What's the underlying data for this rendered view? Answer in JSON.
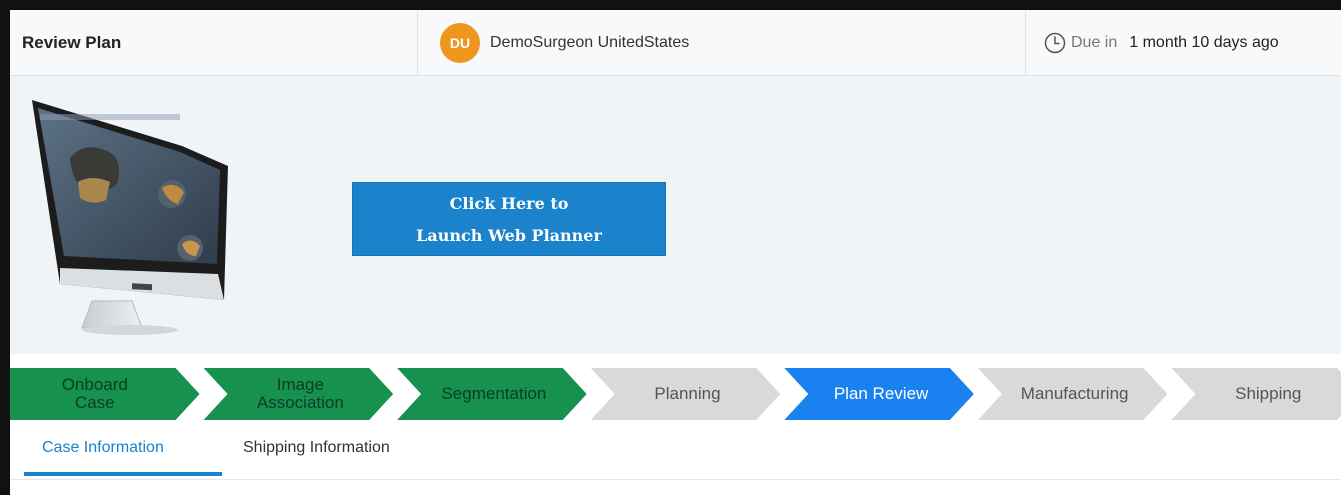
{
  "header": {
    "title": "Review Plan",
    "surgeon": {
      "initials": "DU",
      "name": "DemoSurgeon UnitedStates",
      "avatar_color": "#f0961f"
    },
    "due": {
      "icon": "clock-icon",
      "label": "Due in",
      "value": "1 month 10 days ago"
    }
  },
  "banner": {
    "monitor_image": "computer-monitor-illustration",
    "launch_button": {
      "line1": "Click Here to",
      "line2": "Launch Web Planner",
      "color": "#1a83cc"
    }
  },
  "stepper": {
    "steps": [
      {
        "line1": "Onboard",
        "line2": "Case",
        "status": "complete"
      },
      {
        "line1": "Image",
        "line2": "Association",
        "status": "complete"
      },
      {
        "line1": "Segmentation",
        "line2": "",
        "status": "complete"
      },
      {
        "line1": "Planning",
        "line2": "",
        "status": "pending"
      },
      {
        "line1": "Plan Review",
        "line2": "",
        "status": "active"
      },
      {
        "line1": "Manufacturing",
        "line2": "",
        "status": "pending"
      },
      {
        "line1": "Shipping",
        "line2": "",
        "status": "pending"
      }
    ],
    "colors": {
      "complete": "#17924e",
      "active": "#1a82f0",
      "pending": "#d9d9d9"
    }
  },
  "tabs": {
    "items": [
      {
        "label": "Case Information",
        "active": true
      },
      {
        "label": "Shipping Information",
        "active": false
      }
    ]
  }
}
